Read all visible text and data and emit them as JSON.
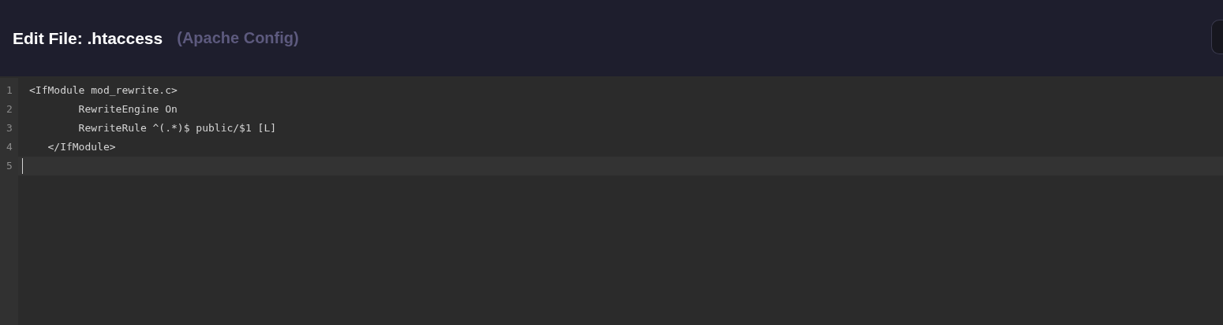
{
  "header": {
    "title": "Edit File: .htaccess",
    "subtitle": "(Apache Config)"
  },
  "editor": {
    "lines": [
      {
        "number": "1",
        "text": "<IfModule mod_rewrite.c>",
        "active": false
      },
      {
        "number": "2",
        "text": "        RewriteEngine On",
        "active": false
      },
      {
        "number": "3",
        "text": "        RewriteRule ^(.*)$ public/$1 [L]",
        "active": false
      },
      {
        "number": "4",
        "text": "   </IfModule>",
        "active": false
      },
      {
        "number": "5",
        "active": true
      }
    ]
  }
}
